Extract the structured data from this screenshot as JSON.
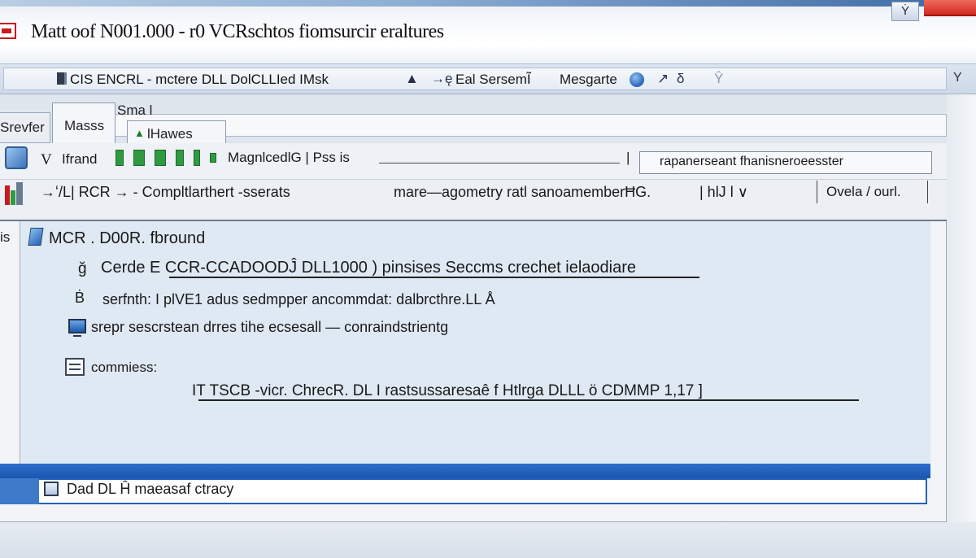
{
  "window": {
    "title": "Matt oof N001.000 - r0 VCRschtos fiomsurcir eraltures",
    "minimize_glyph": "Ẏ",
    "colors": {
      "accent": "#2462ba",
      "close": "#d22a1f",
      "panel": "#dfe9f3"
    }
  },
  "toolbar": {
    "text": "CIS ENCRL -  mctere DLL DolCLLIed IMsk",
    "glyph1": "▲",
    "glyph2": "→ę",
    "text2": "Eal SersemĨ",
    "text3": "Mesgarte",
    "glyph3": "↗",
    "glyph4": "δ",
    "glyph5": "Ŷ",
    "dropdown_glyph": "Y"
  },
  "tabs": [
    {
      "label": "Srevfer"
    },
    {
      "label": "Masss"
    },
    {
      "label": "Sma l"
    },
    {
      "label": "lHawes"
    }
  ],
  "row1": {
    "v_label": "V",
    "pre_label": "Ifrand",
    "field_label": "MagnlcedlG | Pss is",
    "pipe": "|",
    "box_text": "rapanerseant fhanisneroeesster"
  },
  "row2": {
    "text1": "→ʻ/L| RCR → - Compltlarthert -sserats",
    "text2": "mare—agometry ratl sanoamemberĦG.",
    "text3": "| hlJ l  ∨",
    "text4": "Ovela / ourl."
  },
  "tree": {
    "gutter": "is",
    "root": "MCR . D00R. fbround",
    "items": [
      {
        "pre": "ğ",
        "label": "Cerde E CCR-CCADOODĴ DLL1000 ) pinsises Seccms crechet ielaodiare"
      },
      {
        "pre": "Ḃ",
        "label": "serfnth: I  plVE1 adus  sedmpper ancommdat: dalbrcthre.LL Å"
      },
      {
        "label": "srepr sescrstean drres tihe ecsesall  — conraindstrientg"
      },
      {
        "label": "commiess:"
      },
      {
        "label": "IT TSCB  -vicr.  ChrecR. DL I  rastsussaresaê f  Htlrga  DLLL  ö  CDMMP 1,17 ]"
      }
    ]
  },
  "status": {
    "label": "Dad DL  Ĥ maeasaf ctracy"
  }
}
